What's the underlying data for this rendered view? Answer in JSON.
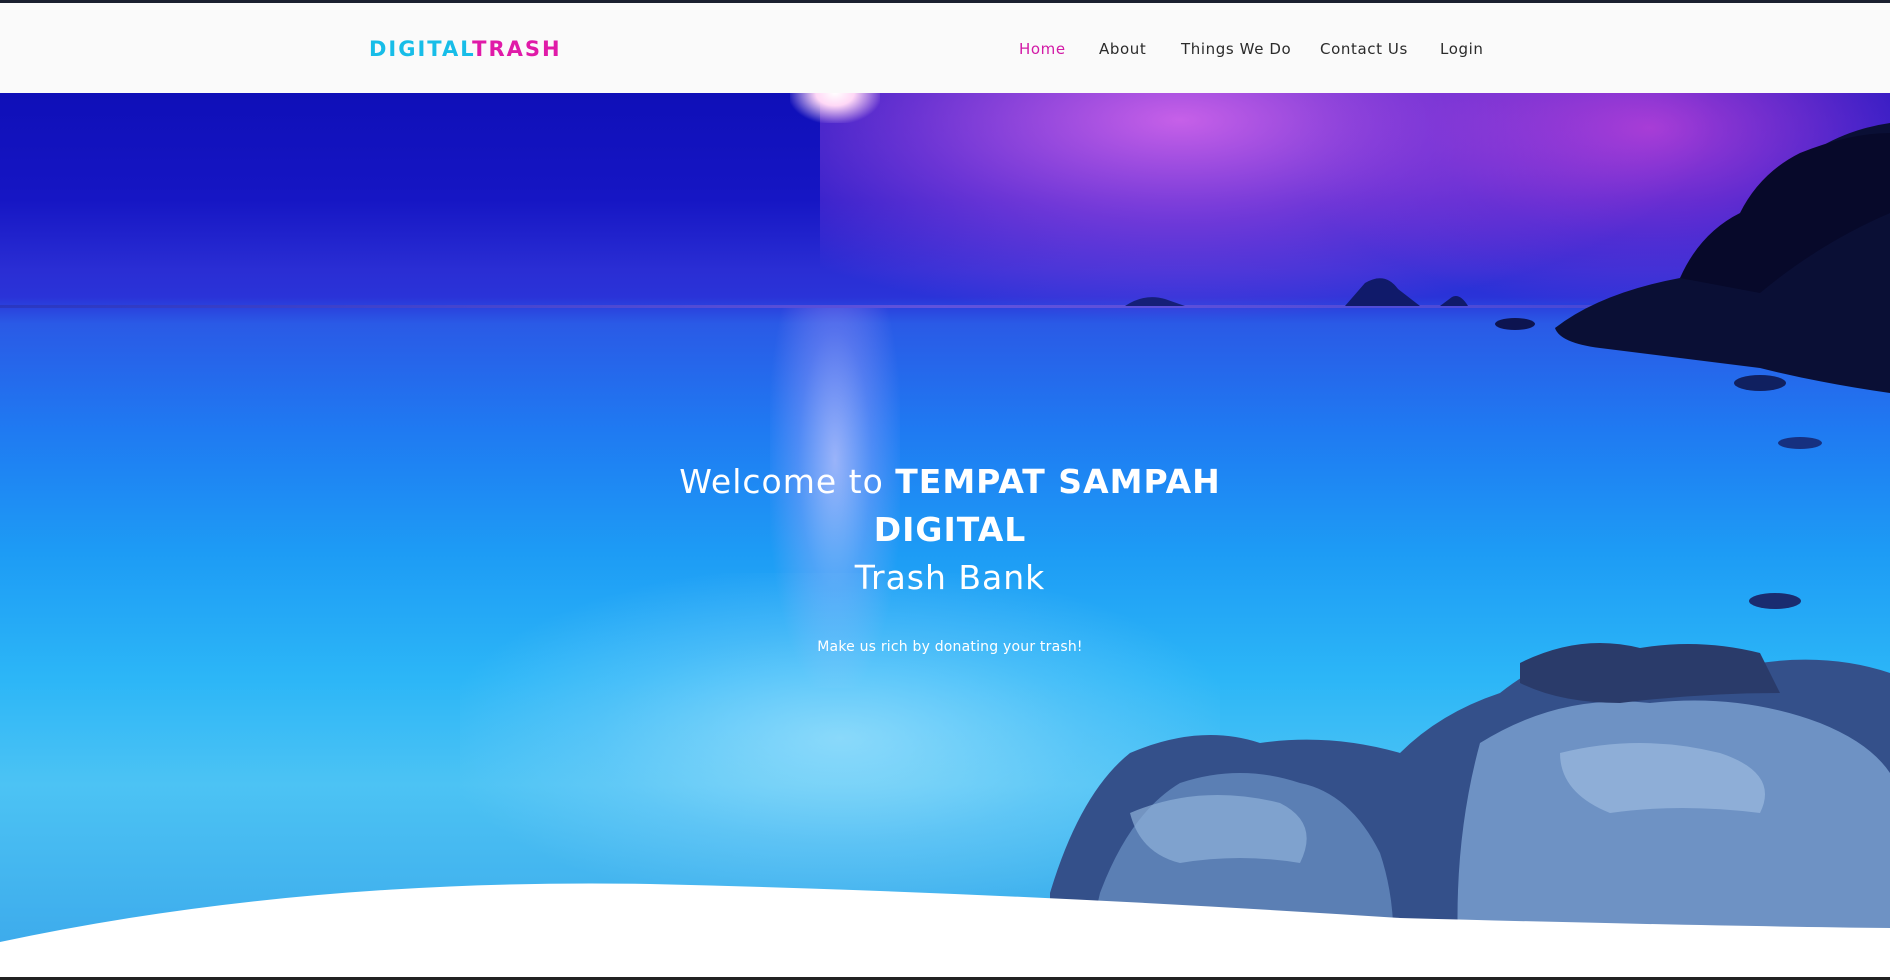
{
  "brand": {
    "part1": "DIGITAL",
    "part2": "TRASH",
    "color1": "#17bde8",
    "color2": "#e01aa8"
  },
  "nav": {
    "active_color": "#d21aa6",
    "items": [
      {
        "label": "Home",
        "active": true
      },
      {
        "label": "About",
        "active": false
      },
      {
        "label": "Things We Do",
        "active": false
      },
      {
        "label": "Contact Us",
        "active": false
      },
      {
        "label": "Login",
        "active": false
      }
    ]
  },
  "hero": {
    "welcome": "Welcome to",
    "name": "TEMPAT SAMPAH DIGITAL",
    "subtitle": "Trash Bank",
    "tagline": "Make us rich by donating your trash!",
    "background": "ocean-sunset-image"
  }
}
